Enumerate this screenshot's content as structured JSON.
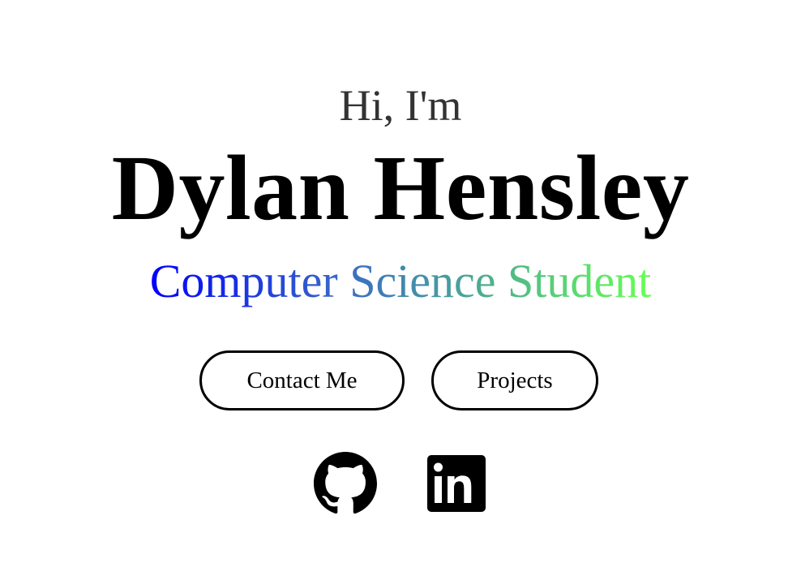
{
  "hero": {
    "greeting": "Hi, I'm",
    "name": "Dylan Hensley",
    "subtitle": "Computer Science Student",
    "subtitle_gradient": [
      "#0000ff",
      "#3a6fc2",
      "#4fb58a",
      "#66ff55"
    ]
  },
  "buttons": {
    "contact_label": "Contact Me",
    "projects_label": "Projects"
  },
  "social": {
    "github_icon": "github-icon",
    "linkedin_icon": "linkedin-icon"
  }
}
